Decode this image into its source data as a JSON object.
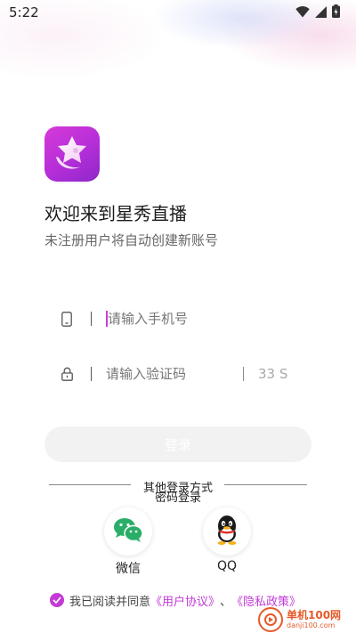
{
  "status_bar": {
    "time": "5:22",
    "icons": [
      "wifi-icon",
      "signal-icon",
      "battery-icon"
    ]
  },
  "app": {
    "logo_icon": "star-moon-icon",
    "welcome_title": "欢迎来到星秀直播",
    "welcome_subtitle": "未注册用户将自动创建新账号"
  },
  "form": {
    "phone": {
      "icon": "phone-icon",
      "placeholder": "请输入手机号",
      "value": ""
    },
    "code": {
      "icon": "lock-icon",
      "placeholder": "请输入验证码",
      "value": "",
      "countdown": "33 S"
    },
    "login_button": "登录"
  },
  "other_login": {
    "label": "其他登录方式",
    "password_login": "密码登录",
    "options": [
      {
        "label": "微信",
        "icon": "wechat-icon"
      },
      {
        "label": "QQ",
        "icon": "qq-icon"
      }
    ]
  },
  "agreement": {
    "checked": true,
    "prefix": "我已阅读并同意",
    "user_agreement": "《用户协议》",
    "separator": "、",
    "privacy_policy": "《隐私政策》"
  },
  "watermark": {
    "cn": "单机100网",
    "en": "danji100.com"
  },
  "colors": {
    "accent": "#c43ad6",
    "logo_gradient_start": "#d63ad8",
    "logo_gradient_end": "#8d27c9",
    "wechat": "#2aae67",
    "button_disabled": "#f2f2f2"
  }
}
